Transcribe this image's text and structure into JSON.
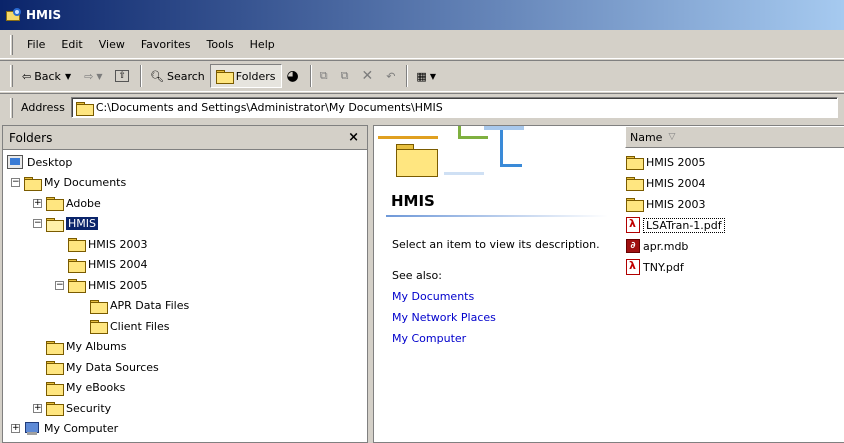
{
  "window": {
    "title": "HMIS"
  },
  "menu": [
    {
      "label": "File"
    },
    {
      "label": "Edit"
    },
    {
      "label": "View"
    },
    {
      "label": "Favorites"
    },
    {
      "label": "Tools"
    },
    {
      "label": "Help"
    }
  ],
  "toolbar": {
    "back_label": "Back",
    "search_label": "Search",
    "folders_label": "Folders"
  },
  "address": {
    "label": "Address",
    "value": "C:\\Documents and Settings\\Administrator\\My Documents\\HMIS"
  },
  "folders_pane": {
    "title": "Folders",
    "close_glyph": "×",
    "tree": [
      {
        "label": "Desktop",
        "level": 0,
        "icon": "desktop-icon",
        "expander": ""
      },
      {
        "label": "My Documents",
        "level": 1,
        "icon": "folder-icon",
        "expander": "−"
      },
      {
        "label": "Adobe",
        "level": 2,
        "icon": "folder-icon",
        "expander": "+"
      },
      {
        "label": "HMIS",
        "level": 2,
        "icon": "folder-open-icon",
        "expander": "−",
        "selected": true
      },
      {
        "label": "HMIS 2003",
        "level": 3,
        "icon": "folder-icon",
        "expander": ""
      },
      {
        "label": "HMIS 2004",
        "level": 3,
        "icon": "folder-icon",
        "expander": ""
      },
      {
        "label": "HMIS 2005",
        "level": 3,
        "icon": "folder-icon",
        "expander": "−"
      },
      {
        "label": "APR Data Files",
        "level": 4,
        "icon": "folder-icon",
        "expander": ""
      },
      {
        "label": "Client Files",
        "level": 4,
        "icon": "folder-icon",
        "expander": ""
      },
      {
        "label": "My Albums",
        "level": 2,
        "icon": "folder-icon",
        "expander": ""
      },
      {
        "label": "My Data Sources",
        "level": 2,
        "icon": "folder-icon",
        "expander": ""
      },
      {
        "label": "My eBooks",
        "level": 2,
        "icon": "folder-icon",
        "expander": ""
      },
      {
        "label": "Security",
        "level": 2,
        "icon": "folder-icon",
        "expander": "+"
      },
      {
        "label": "My Computer",
        "level": 1,
        "icon": "computer-icon",
        "expander": "+"
      }
    ]
  },
  "info_pane": {
    "title": "HMIS",
    "description": "Select an item to view its description.",
    "see_also": "See also:",
    "links": [
      "My Documents",
      "My Network Places",
      "My Computer"
    ]
  },
  "files": {
    "column_name": "Name",
    "sort_glyph": "▽",
    "items": [
      {
        "name": "HMIS 2005",
        "type": "folder"
      },
      {
        "name": "HMIS 2004",
        "type": "folder"
      },
      {
        "name": "HMIS 2003",
        "type": "folder"
      },
      {
        "name": "LSATran-1.pdf",
        "type": "pdf",
        "focused": true
      },
      {
        "name": "apr.mdb",
        "type": "mdb"
      },
      {
        "name": "TNY.pdf",
        "type": "pdf"
      }
    ]
  }
}
